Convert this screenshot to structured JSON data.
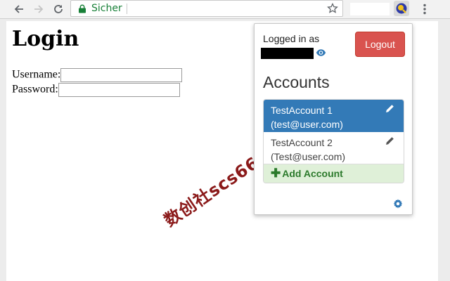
{
  "browser": {
    "security_label": "Sicher"
  },
  "page": {
    "title": "Login",
    "username_label": "Username:",
    "password_label": "Password:",
    "watermark": "数创社scs66"
  },
  "popup": {
    "logged_in_label": "Logged in as",
    "logout_label": "Logout",
    "accounts_title": "Accounts",
    "accounts": [
      {
        "name": "TestAccount 1",
        "email": "(test@user.com)",
        "active": true
      },
      {
        "name": "TestAccount 2",
        "email": "(Test@user.com)",
        "active": false
      }
    ],
    "add_account_label": "Add Account"
  },
  "colors": {
    "accent": "#337ab7",
    "danger": "#d9534f",
    "success_bg": "#dff0d8",
    "secure_green": "#188038"
  },
  "icons": [
    "back-icon",
    "forward-icon",
    "reload-icon",
    "lock-icon",
    "star-icon",
    "extension-icon",
    "menu-icon",
    "eye-icon",
    "pencil-icon",
    "plus-icon",
    "gear-icon"
  ]
}
